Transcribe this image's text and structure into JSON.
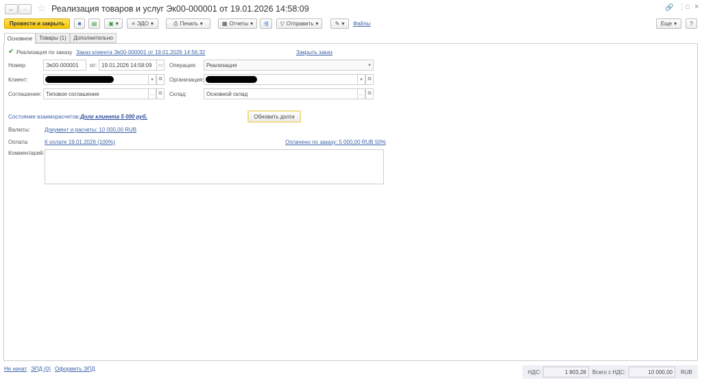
{
  "window": {
    "title": "Реализация товаров и услуг Эк00-000001 от 19.01.2026 14:58:09"
  },
  "toolbar": {
    "post_close": "Провести и закрыть",
    "edo": "ЭДО",
    "print": "Печать",
    "reports": "Отчеты",
    "send": "Отправить",
    "files": "Файлы",
    "more": "Еще",
    "help": "?"
  },
  "tabs": [
    {
      "label": "Основное"
    },
    {
      "label": "Товары (1)"
    },
    {
      "label": "Дополнительно"
    }
  ],
  "form": {
    "by_order_label": "Реализация по заказу",
    "by_order_checked": true,
    "order_link": "Заказ клиента Эк00-000001 от 19.01.2026 14:56:32",
    "close_order": "Закрыть заказ",
    "number_label": "Номер:",
    "number": "Эк00-000001",
    "date_label": "от:",
    "date": "19.01.2026 14:58:09",
    "operation_label": "Операция:",
    "operation": "Реализация",
    "client_label": "Клиент:",
    "org_label": "Организация:",
    "agreement_label": "Соглашение:",
    "agreement": "Типовое соглашение",
    "warehouse_label": "Склад:",
    "warehouse": "Основной склад",
    "settlements_label": "Состояние взаиморасчетов:",
    "settlements_link": "Долг клиента 5 000 руб.",
    "refresh_debts": "Обновить долги",
    "currency_label": "Валюты:",
    "currency_link": "Документ и расчеты: 10 000,00 RUB",
    "payment_label": "Оплата:",
    "payment_link": "К оплате 19.01.2026 (100%)",
    "paid_link": "Оплачено по заказу: 5 000,00 RUB 50%",
    "comment_label": "Комментарий:",
    "comment": ""
  },
  "footer": {
    "status": "Не начат",
    "epd": "ЭПД (0)",
    "make_epd": "Оформить ЭПД",
    "vat_label": "НДС:",
    "vat": "1 803,28",
    "total_label": "Всего с НДС:",
    "total": "10 000,00",
    "currency": "RUB"
  }
}
